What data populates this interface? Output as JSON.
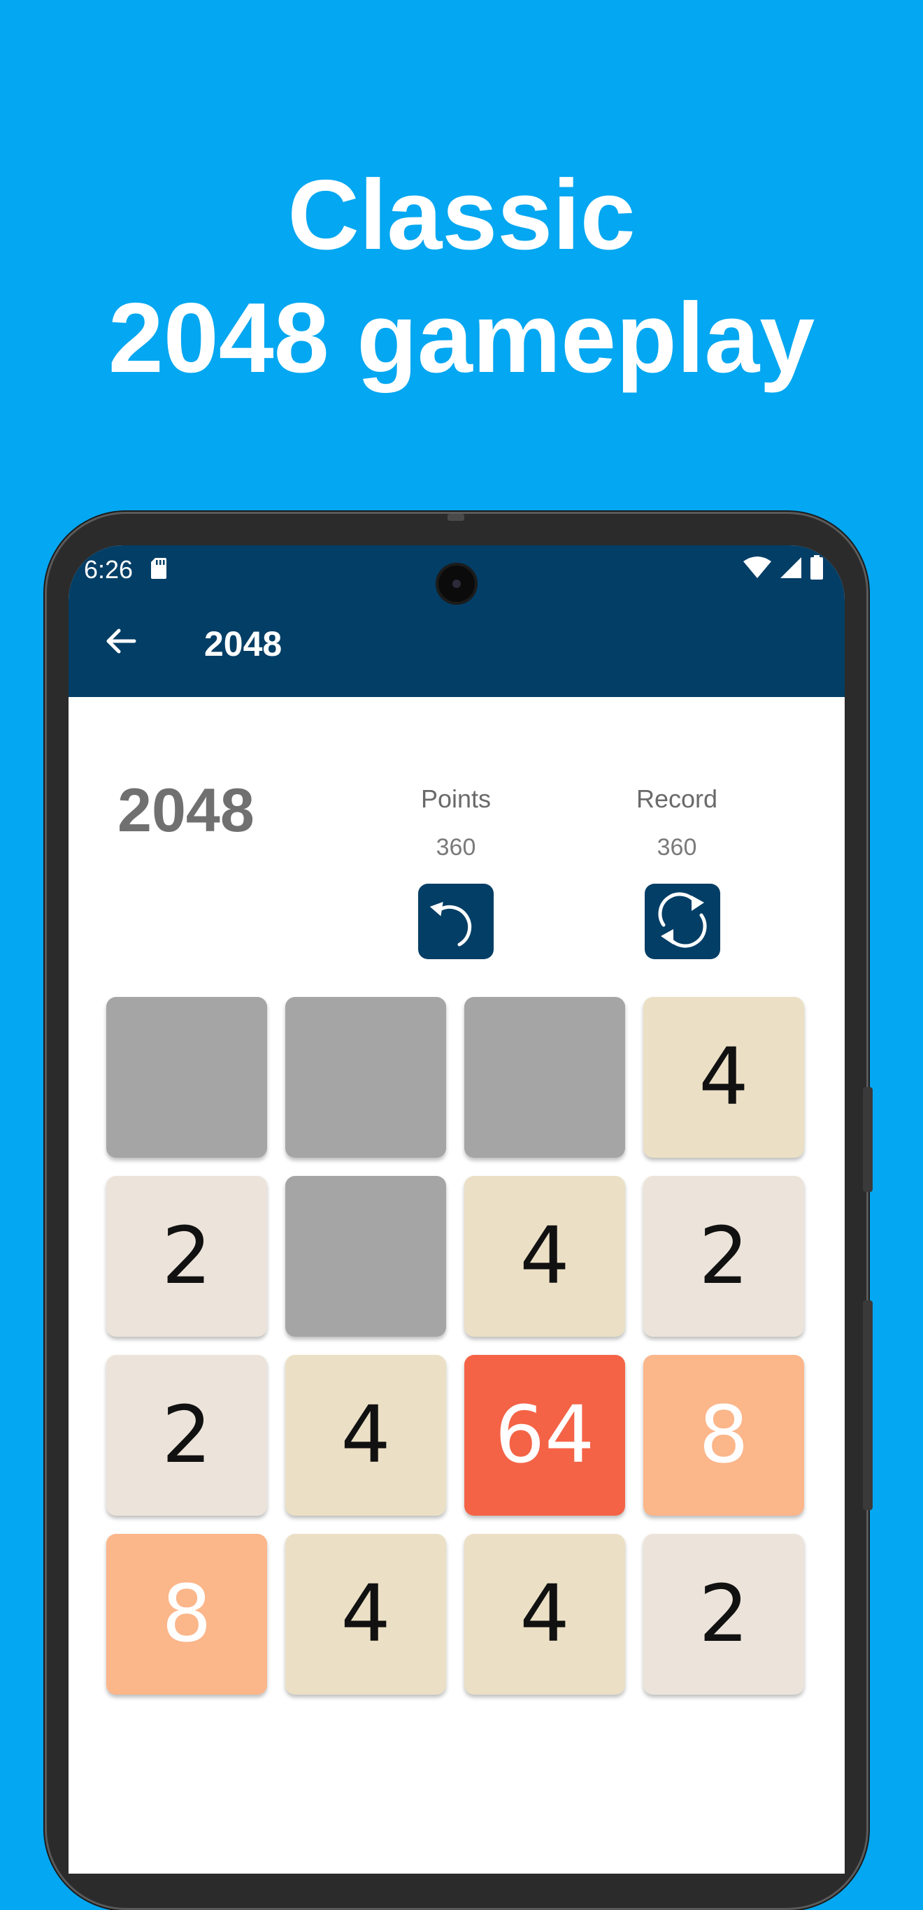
{
  "promo": {
    "line1": "Classic",
    "line2": "2048 gameplay"
  },
  "statusbar": {
    "time": "6:26"
  },
  "appbar": {
    "back_icon": "arrow-left-icon",
    "title": "2048"
  },
  "game": {
    "title": "2048",
    "points_label": "Points",
    "points_value": "360",
    "record_label": "Record",
    "record_value": "360",
    "undo_icon": "undo-icon",
    "restart_icon": "restart-icon"
  },
  "colors": {
    "background": "#04a7f1",
    "appbar": "#033e66",
    "empty": "#a5a5a5",
    "tile_2": "#ece4da",
    "tile_4": "#ebe0c5",
    "tile_8": "#fbb68a",
    "tile_64": "#f46346"
  },
  "board": {
    "rows": [
      [
        "",
        "",
        "",
        "4"
      ],
      [
        "2",
        "",
        "4",
        "2"
      ],
      [
        "2",
        "4",
        "64",
        "8"
      ],
      [
        "8",
        "4",
        "4",
        "2"
      ]
    ]
  }
}
